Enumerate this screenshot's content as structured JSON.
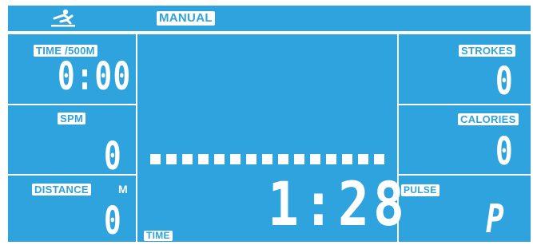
{
  "header": {
    "mode_icon": "rower-icon",
    "mode_label": "MANUAL"
  },
  "left": {
    "time_500m": {
      "label": "TIME /500M",
      "value": "0:00"
    },
    "spm": {
      "label": "SPM",
      "value": "0"
    },
    "distance": {
      "label": "DISTANCE",
      "unit": "M",
      "value": "0"
    }
  },
  "center": {
    "bar_segments_lit": 15,
    "bar_segments_total": 15,
    "time": {
      "label": "TIME",
      "value": "1:28"
    }
  },
  "right": {
    "strokes": {
      "label": "STROKES",
      "value": "0"
    },
    "calories": {
      "label": "CALORIES",
      "value": "0"
    },
    "pulse": {
      "label": "PULSE",
      "value": "P"
    }
  },
  "colors": {
    "lcd_background": "#2fa3dd",
    "segment": "#ffffff"
  }
}
